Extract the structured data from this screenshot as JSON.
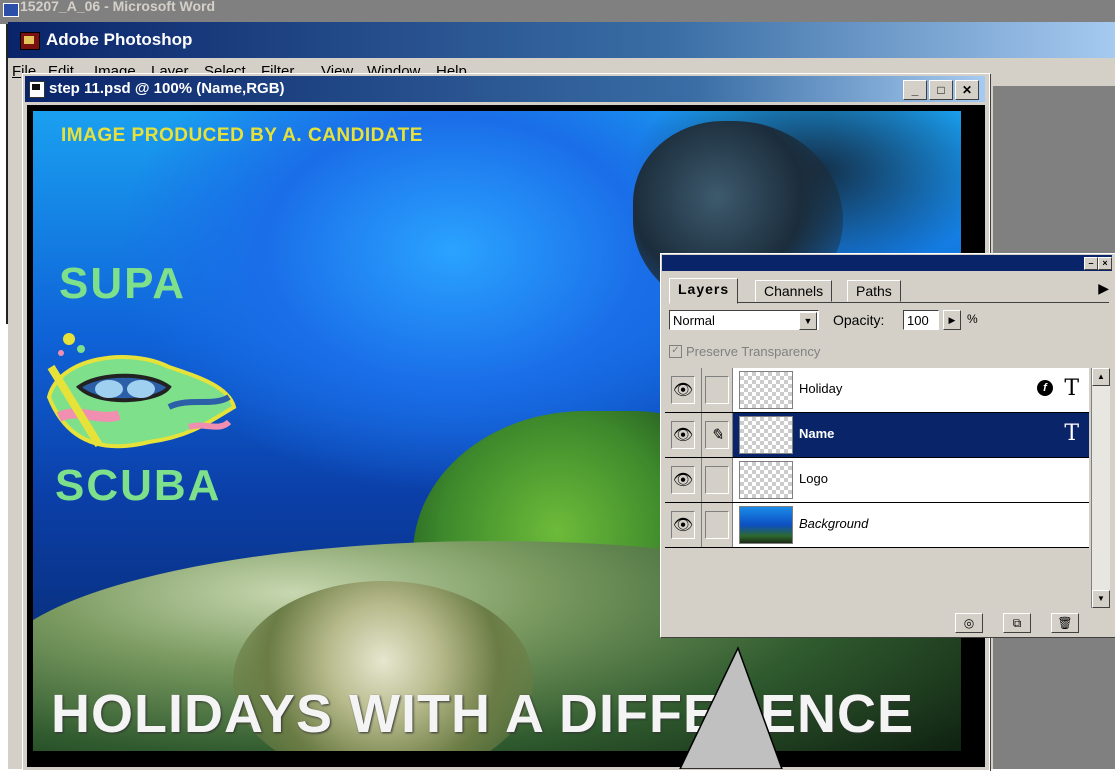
{
  "word": {
    "title": "15207_A_06 - Microsoft Word"
  },
  "app": {
    "title": "Adobe Photoshop"
  },
  "menu": [
    {
      "label": "File",
      "u": "F",
      "rest": "ile"
    },
    {
      "label": "Edit",
      "u": "E",
      "rest": "dit"
    },
    {
      "label": "Image",
      "u": "I",
      "rest": "mage"
    },
    {
      "label": "Layer",
      "u": "L",
      "rest": "ayer"
    },
    {
      "label": "Select",
      "u": "S",
      "rest": "elect"
    },
    {
      "label": "Filter",
      "pre": "Fil",
      "u": "t",
      "rest": "er"
    },
    {
      "label": "View",
      "u": "V",
      "rest": "iew"
    },
    {
      "label": "Window",
      "u": "W",
      "rest": "indow"
    },
    {
      "label": "Help",
      "u": "H",
      "rest": "elp"
    }
  ],
  "document": {
    "title": "step 11.psd @ 100% (Name,RGB)",
    "buttons": [
      "_",
      "□",
      "✕"
    ]
  },
  "artwork": {
    "caption": "IMAGE PRODUCED BY A. CANDIDATE",
    "logo_top": "SUPA",
    "logo_bottom": "SCUBA",
    "headline": "HOLIDAYS WITH A DIFFERENCE"
  },
  "layers_palette": {
    "tabs": [
      "Layers",
      "Channels",
      "Paths"
    ],
    "active_tab": "Layers",
    "blend_mode": "Normal",
    "opacity_label": "Opacity:",
    "opacity_value": "100",
    "opacity_unit": "%",
    "preserve_transparency": "Preserve Transparency",
    "layers": [
      {
        "name": "Holiday",
        "visible": true,
        "selected": false,
        "type": "text",
        "has_effect": true
      },
      {
        "name": "Name",
        "visible": true,
        "selected": true,
        "type": "text",
        "has_effect": false
      },
      {
        "name": "Logo",
        "visible": true,
        "selected": false,
        "type": "pixel",
        "has_effect": false
      },
      {
        "name": "Background",
        "visible": true,
        "selected": false,
        "type": "background",
        "has_effect": false
      }
    ]
  },
  "colors": {
    "title_bar": "#0a246a",
    "caption_yellow": "#e7e23a",
    "logo_green": "#7ee08a",
    "selected_layer": "#0a246a"
  }
}
